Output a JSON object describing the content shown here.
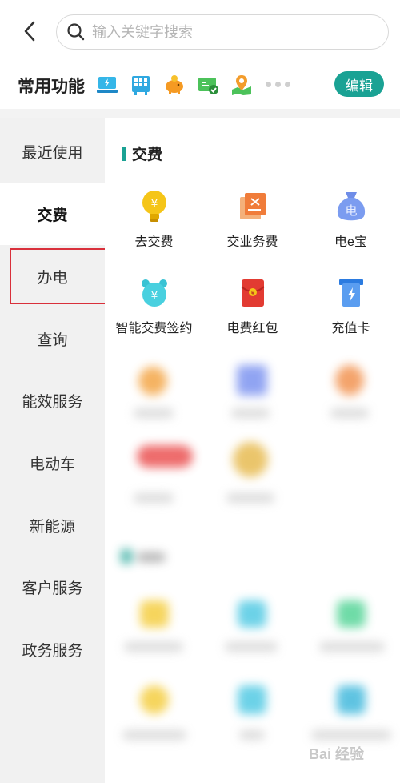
{
  "search": {
    "placeholder": "输入关键字搜索"
  },
  "favorites": {
    "title": "常用功能",
    "icons": [
      "laptop-bolt-icon",
      "building-icon",
      "piggy-bank-icon",
      "bill-check-icon",
      "map-pin-icon"
    ],
    "edit_label": "编辑"
  },
  "sidebar": {
    "items": [
      {
        "label": "最近使用"
      },
      {
        "label": "交费",
        "active": true
      },
      {
        "label": "办电"
      },
      {
        "label": "查询"
      },
      {
        "label": "能效服务"
      },
      {
        "label": "电动车"
      },
      {
        "label": "新能源"
      },
      {
        "label": "客户服务"
      },
      {
        "label": "政务服务"
      }
    ]
  },
  "section": {
    "title": "交费",
    "items": [
      {
        "label": "去交费",
        "icon": "lightbulb-yuan-icon"
      },
      {
        "label": "交业务费",
        "icon": "fee-document-icon"
      },
      {
        "label": "电e宝",
        "icon": "money-bag-icon"
      },
      {
        "label": "智能交费签约",
        "icon": "alarm-clock-icon"
      },
      {
        "label": "电费红包",
        "icon": "red-envelope-icon"
      },
      {
        "label": "充值卡",
        "icon": "recharge-card-icon"
      }
    ]
  },
  "watermark": "Bai 经验",
  "colors": {
    "accent": "#1aa294",
    "highlight": "#d9303b",
    "nav_bg": "#f1f1f1"
  }
}
